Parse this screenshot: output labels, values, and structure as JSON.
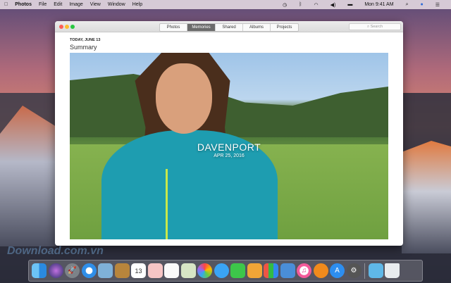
{
  "menubar": {
    "app": "Photos",
    "items": [
      "File",
      "Edit",
      "Image",
      "View",
      "Window",
      "Help"
    ],
    "clock": "Mon 9:41 AM"
  },
  "window": {
    "tabs": [
      {
        "label": "Photos",
        "active": false
      },
      {
        "label": "Memories",
        "active": true
      },
      {
        "label": "Shared",
        "active": false
      },
      {
        "label": "Albums",
        "active": false
      },
      {
        "label": "Projects",
        "active": false
      }
    ],
    "search_placeholder": "Search",
    "date": "TODAY, JUNE 13",
    "section": "Summary",
    "memory": {
      "title": "DAVENPORT",
      "date": "APR 25, 2016"
    }
  },
  "watermark": "Download.com.vn",
  "dock": [
    "finder",
    "siri",
    "launchpad",
    "safari",
    "preview",
    "contacts",
    "calendar",
    "notes",
    "reminders",
    "maps",
    "photos",
    "messages",
    "facetime",
    "pages",
    "numbers",
    "keynote",
    "itunes",
    "ibooks",
    "app-store",
    "system-preferences",
    "downloads",
    "trash"
  ],
  "calendar_day": "13"
}
